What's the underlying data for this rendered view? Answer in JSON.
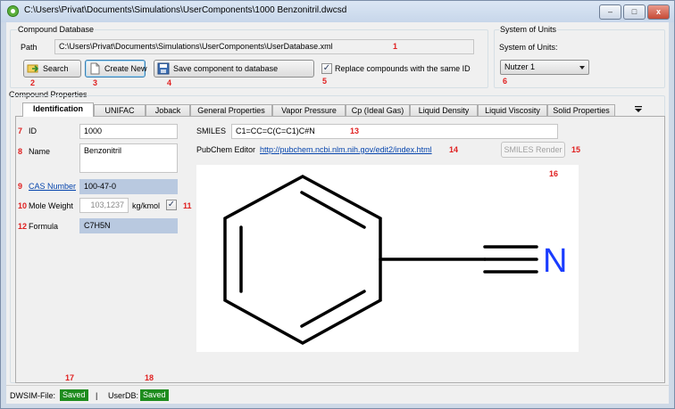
{
  "window": {
    "title": "C:\\Users\\Privat\\Documents\\Simulations\\UserComponents\\1000 Benzonitril.dwcsd",
    "min_label": "–",
    "max_label": "□",
    "close_label": "x"
  },
  "compound_db": {
    "group_label": "Compound Database",
    "path_label": "Path",
    "path_value": "C:\\Users\\Privat\\Documents\\Simulations\\UserComponents\\UserDatabase.xml",
    "search_label": "Search",
    "create_new_label": "Create New",
    "save_label": "Save component to database",
    "replace_label": "Replace compounds with the same ID",
    "replace_checked": "✓"
  },
  "units": {
    "group_label": "System of Units",
    "label": "System of Units:",
    "selected": "Nutzer 1"
  },
  "properties": {
    "group_label": "Compound Properties",
    "tabs": [
      {
        "label": "Identification",
        "active": true
      },
      {
        "label": "UNIFAC"
      },
      {
        "label": "Joback"
      },
      {
        "label": "General Properties"
      },
      {
        "label": "Vapor Pressure"
      },
      {
        "label": "Cp (Ideal Gas)"
      },
      {
        "label": "Liquid Density"
      },
      {
        "label": "Liquid Viscosity"
      },
      {
        "label": "Solid Properties"
      }
    ],
    "tab_overflow_icon": "chevron-down-icon"
  },
  "identification": {
    "id_label": "ID",
    "id_value": "1000",
    "name_label": "Name",
    "name_value": "Benzonitril",
    "cas_label": "CAS Number",
    "cas_value": "100-47-0",
    "mw_label": "Mole Weight",
    "mw_value": "103,1237",
    "mw_unit": "kg/kmol",
    "mw_checked": "✓",
    "formula_label": "Formula",
    "formula_value": "C7H5N",
    "smiles_label": "SMILES",
    "smiles_value": "C1=CC=C(C=C1)C#N",
    "pubchem_label": "PubChem Editor",
    "pubchem_link": "http://pubchem.ncbi.nlm.nih.gov/edit2/index.html",
    "smiles_render_label": "SMILES Render",
    "structure_atom_label": "N"
  },
  "annotations": [
    "1",
    "2",
    "3",
    "4",
    "5",
    "6",
    "7",
    "8",
    "9",
    "10",
    "11",
    "12",
    "13",
    "14",
    "15",
    "16",
    "17",
    "18"
  ],
  "status": {
    "file_label": "DWSIM-File:",
    "file_status": "Saved",
    "separator": "|",
    "userdb_label": "UserDB:",
    "userdb_status": "Saved"
  },
  "colors": {
    "annotation": "#e02020",
    "saved_bg": "#1e8c1e",
    "link": "#0645ad",
    "nitrogen": "#1a3cff"
  }
}
